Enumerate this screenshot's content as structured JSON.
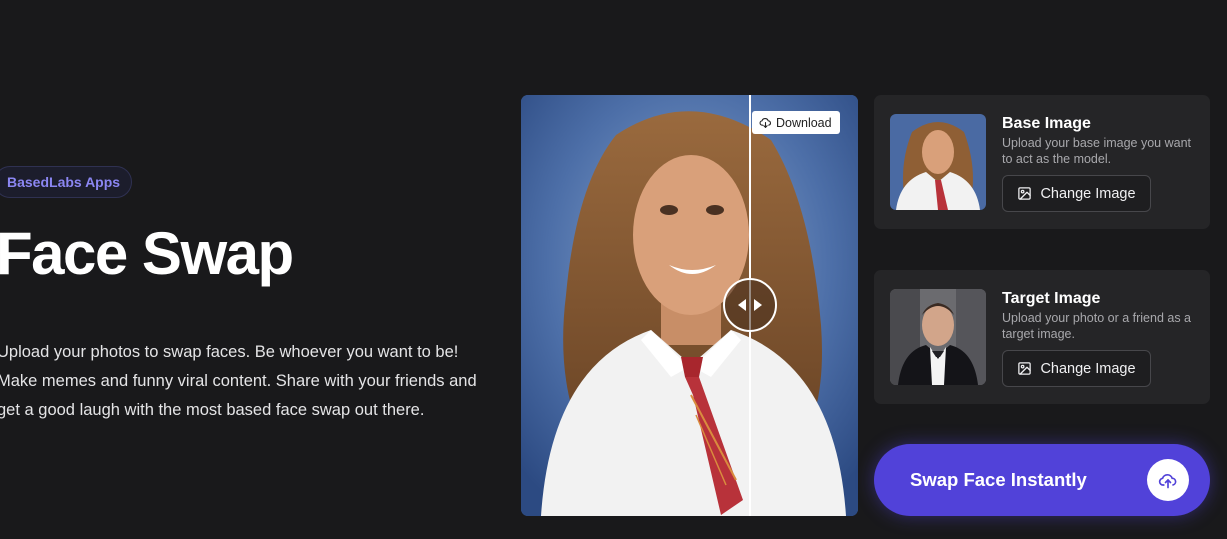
{
  "badge": "BasedLabs Apps",
  "title": "Face Swap",
  "description": "Upload your photos to swap faces. Be whoever you want to be! Make memes and funny viral content. Share with your friends and get a good laugh with the most based face swap out there.",
  "preview": {
    "download_label": "Download",
    "icons": {
      "download": "cloud-download-icon",
      "handle": "compare-slider-icon"
    }
  },
  "base_card": {
    "title": "Base Image",
    "description": "Upload your base image you want to act as the model.",
    "button_label": "Change Image",
    "icon": "image-icon"
  },
  "target_card": {
    "title": "Target Image",
    "description": "Upload your photo or a friend as a target image.",
    "button_label": "Change Image",
    "icon": "image-icon"
  },
  "cta": {
    "label": "Swap Face Instantly",
    "icon": "cloud-upload-icon"
  },
  "colors": {
    "background": "#19191b",
    "card": "#252527",
    "accent": "#5142d9",
    "badge_text": "#8b86f2"
  }
}
